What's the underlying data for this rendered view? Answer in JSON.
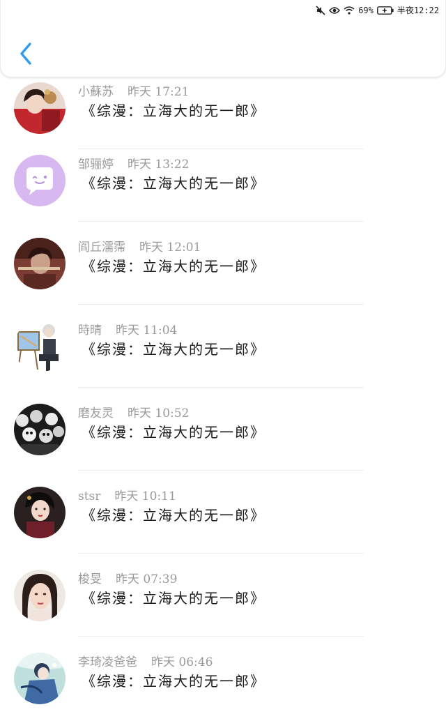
{
  "status_bar": {
    "battery": "69%",
    "time": "半夜12:22",
    "icons": [
      "mute-icon",
      "eye-icon",
      "wifi-icon",
      "battery-icon"
    ]
  },
  "header": {
    "back_icon": "chevron-left-icon",
    "accent": "#2f9bf0"
  },
  "items": [
    {
      "name": "小蘇苏",
      "time": "昨天 17:21",
      "content": "《综漫：立海大的无一郎》",
      "avatar": "avatar-photo-red"
    },
    {
      "name": "邹骊婷",
      "time": "昨天 13:22",
      "content": "《综漫：立海大的无一郎》",
      "avatar": "avatar-default-chat-icon"
    },
    {
      "name": "阎丘濡霈",
      "time": "昨天 12:01",
      "content": "《综漫：立海大的无一郎》",
      "avatar": "avatar-photo-flute"
    },
    {
      "name": "時晴",
      "time": "昨天 11:04",
      "content": "《综漫：立海大的无一郎》",
      "avatar": "avatar-photo-painter"
    },
    {
      "name": "磨友灵",
      "time": "昨天 10:52",
      "content": "《综漫：立海大的无一郎》",
      "avatar": "avatar-photo-skulls"
    },
    {
      "name": "stsr",
      "time": "昨天 10:11",
      "content": "《综漫：立海大的无一郎》",
      "avatar": "avatar-photo-ancient-girl"
    },
    {
      "name": "梭旻",
      "time": "昨天 07:39",
      "content": "《综漫：立海大的无一郎》",
      "avatar": "avatar-photo-woman"
    },
    {
      "name": "李琦凌爸爸",
      "time": "昨天 06:46",
      "content": "《综漫：立海大的无一郎》",
      "avatar": "avatar-photo-anime"
    }
  ]
}
